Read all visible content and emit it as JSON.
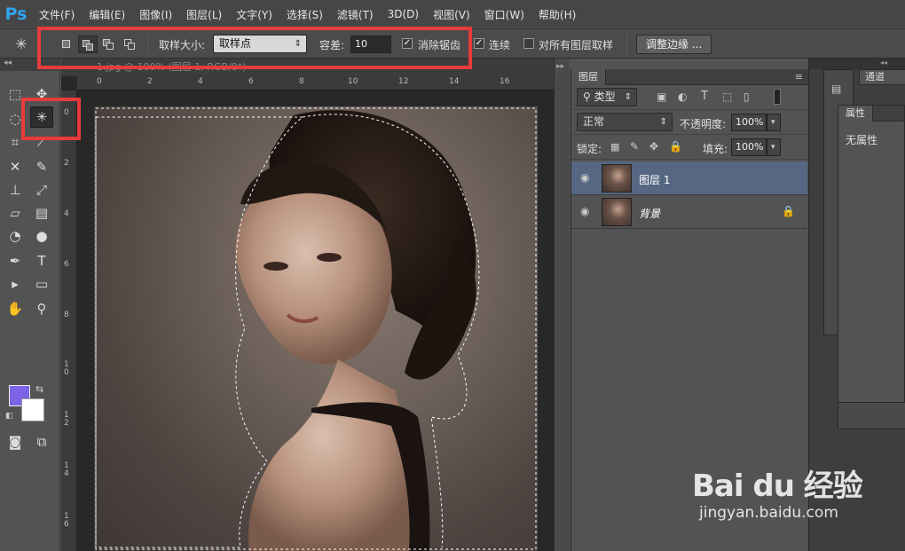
{
  "app": {
    "logo": "Ps"
  },
  "menu": [
    "文件(F)",
    "编辑(E)",
    "图像(I)",
    "图层(L)",
    "文字(Y)",
    "选择(S)",
    "滤镜(T)",
    "3D(D)",
    "视图(V)",
    "窗口(W)",
    "帮助(H)"
  ],
  "options": {
    "tool_icon": "magic-wand-icon",
    "sample_size_label": "取样大小:",
    "sample_size_value": "取样点",
    "tolerance_label": "容差:",
    "tolerance_value": "10",
    "antialias_label": "消除锯齿",
    "antialias_checked": true,
    "contiguous_label": "连续",
    "contiguous_checked": true,
    "all_layers_label": "对所有图层取样",
    "all_layers_checked": false,
    "refine_edge_label": "调整边缘 ..."
  },
  "document": {
    "tab_title": "1.jpg @ 100% (图层 1, RGB/8*)",
    "ruler_top": [
      "0",
      "2",
      "4",
      "6",
      "8",
      "10",
      "12",
      "14",
      "16"
    ],
    "ruler_left": [
      "0",
      "2",
      "4",
      "6",
      "8",
      "1 0",
      "1 2",
      "1 4",
      "1 6"
    ]
  },
  "colors": {
    "foreground": "#7d63e6",
    "background": "#ffffff",
    "highlight": "#e83b3b",
    "selected_layer": "#566783"
  },
  "layers_panel": {
    "title": "图层",
    "filter_label": "类型",
    "blend_mode": "正常",
    "opacity_label": "不透明度:",
    "opacity_value": "100%",
    "lock_label": "锁定:",
    "fill_label": "填充:",
    "fill_value": "100%",
    "layers": [
      {
        "name": "图层 1",
        "selected": true,
        "locked": false
      },
      {
        "name": "背景",
        "selected": false,
        "locked": true
      }
    ]
  },
  "channels_panel": {
    "title": "通道"
  },
  "properties_panel": {
    "title": "属性",
    "content": "无属性"
  },
  "watermark": {
    "brand": "Bai du 经验",
    "url": "jingyan.baidu.com"
  }
}
